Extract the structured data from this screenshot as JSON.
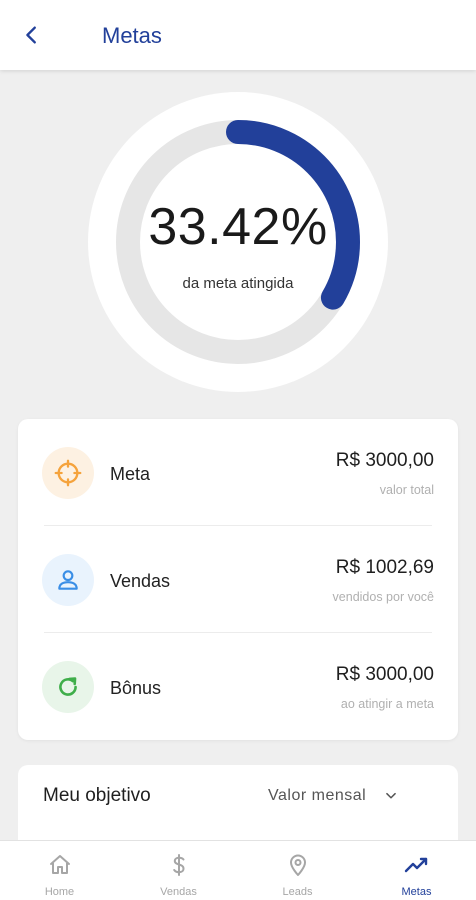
{
  "header": {
    "title": "Metas",
    "back_icon": "chevron-left-icon"
  },
  "gauge": {
    "value_label": "33.42%",
    "progress_fraction": 0.3342,
    "caption": "da meta atingida",
    "colors": {
      "track": "#e6e6e6",
      "progress": "#22409a"
    }
  },
  "summary": {
    "rows": [
      {
        "icon": "target-icon",
        "label": "Meta",
        "amount": "R$ 3000,00",
        "sub": "valor total",
        "icon_color": "#f5a33c",
        "icon_bg": "#fdf1e2"
      },
      {
        "icon": "user-icon",
        "label": "Vendas",
        "amount": "R$ 1002,69",
        "sub": "vendidos por você",
        "icon_color": "#3a8ee6",
        "icon_bg": "#e9f3fd"
      },
      {
        "icon": "refresh-icon",
        "label": "Bônus",
        "amount": "R$ 3000,00",
        "sub": "ao atingir a meta",
        "icon_color": "#3fae4a",
        "icon_bg": "#e8f5e9"
      }
    ]
  },
  "objective": {
    "title": "Meu objetivo",
    "selected": "Valor mensal"
  },
  "nav": {
    "items": [
      {
        "label": "Home",
        "icon": "home-icon",
        "active": false
      },
      {
        "label": "Vendas",
        "icon": "dollar-icon",
        "active": false
      },
      {
        "label": "Leads",
        "icon": "location-pin-icon",
        "active": false
      },
      {
        "label": "Metas",
        "icon": "trending-up-icon",
        "active": true
      }
    ]
  }
}
